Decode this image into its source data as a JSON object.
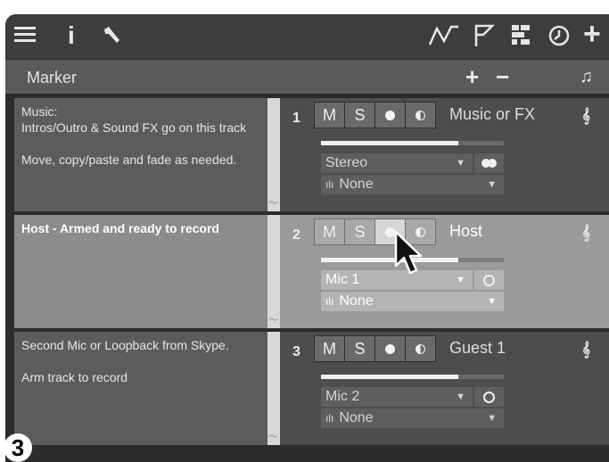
{
  "toolbar": {
    "left_icons": [
      "menu-icon",
      "info-icon",
      "wrench-icon"
    ],
    "right_icons": [
      "automation-icon",
      "marker-flag-icon",
      "arranger-icon",
      "clock-icon",
      "add-icon"
    ],
    "info_glyph": "i",
    "add_glyph": "+"
  },
  "marker_bar": {
    "title": "Marker",
    "add_label": "+",
    "remove_label": "−",
    "music_icon": "♫"
  },
  "track_buttons": {
    "mute": "M",
    "solo": "S"
  },
  "tracks": [
    {
      "number": "1",
      "name": "Music or FX",
      "note": [
        "Music:",
        "Intros/Outro & Sound FX go on this track",
        "",
        "Move, copy/paste and fade as needed."
      ],
      "input": "Stereo",
      "output": "None",
      "meter_level": 0.75,
      "armed": false,
      "selected": false
    },
    {
      "number": "2",
      "name": "Host",
      "note": [
        "Host - Armed and ready to record"
      ],
      "input": "Mic 1",
      "output": "None",
      "meter_level": 0.75,
      "armed": true,
      "selected": true
    },
    {
      "number": "3",
      "name": "Guest 1",
      "note": [
        "Second Mic or Loopback from Skype.",
        "",
        "Arm track to record"
      ],
      "input": "Mic 2",
      "output": "None",
      "meter_level": 0.75,
      "armed": false,
      "selected": false
    }
  ],
  "step_badge": "3",
  "colors": {
    "window_bg": "#3b3b3b",
    "selected_track": "#9a9a9a",
    "note_bg": "#5c5c5c"
  }
}
